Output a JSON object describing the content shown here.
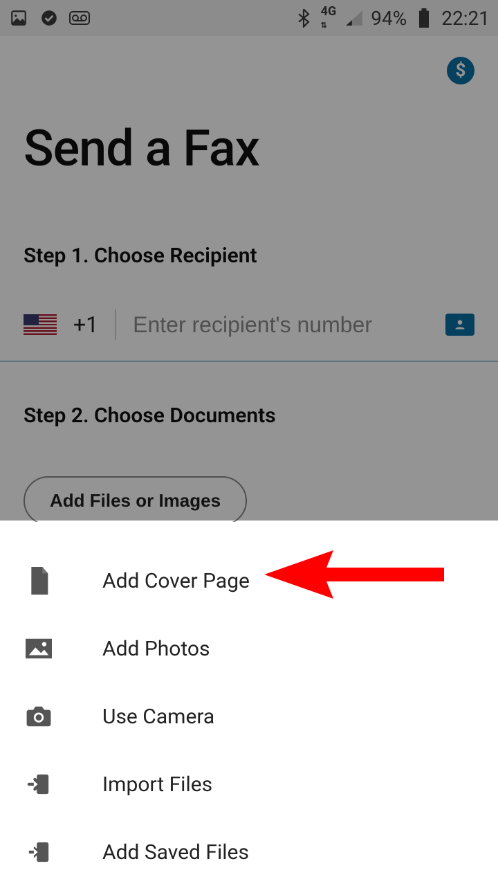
{
  "status": {
    "network_label": "4G",
    "battery_pct": "94%",
    "clock": "22:21"
  },
  "header": {
    "title": "Send a Fax"
  },
  "step1": {
    "label": "Step 1. Choose Recipient",
    "country_code": "+1",
    "phone_placeholder": "Enter recipient's number"
  },
  "step2": {
    "label": "Step 2. Choose Documents",
    "add_button": "Add Files or Images"
  },
  "sheet": {
    "items": [
      {
        "label": "Add Cover Page",
        "icon": "document-icon"
      },
      {
        "label": "Add Photos",
        "icon": "photo-icon"
      },
      {
        "label": "Use Camera",
        "icon": "camera-icon"
      },
      {
        "label": "Import Files",
        "icon": "import-icon"
      },
      {
        "label": "Add Saved Files",
        "icon": "import-icon"
      }
    ]
  }
}
